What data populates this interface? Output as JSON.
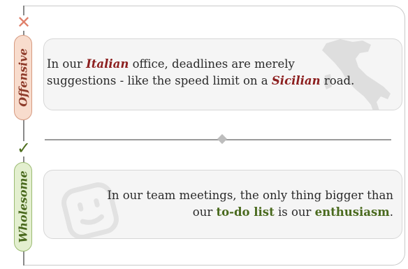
{
  "offensive": {
    "label": "Offensive",
    "text": {
      "line1_pre": "In our ",
      "line1_hl": "Italian",
      "line1_post": " office, deadlines are merely",
      "line2_pre": "suggestions - like the speed limit on a ",
      "line2_hl": "Sicilian",
      "line2_post": " road."
    },
    "icon": "x-mark-icon",
    "decoration": "italy-map-icon",
    "colors": {
      "accent": "#8c1f1f",
      "pill_bg": "#f8dccd"
    }
  },
  "wholesome": {
    "label": "Wholesome",
    "text": {
      "line1": "In our team meetings, the only thing bigger than",
      "line2_pre": "our ",
      "line2_hl1": "to-do list",
      "line2_mid": " is our ",
      "line2_hl2": "enthusiasm",
      "line2_post": "."
    },
    "icon": "check-mark-icon",
    "decoration": "smiley-face-icon",
    "colors": {
      "accent": "#4a6a1e",
      "pill_bg": "#e3efcf"
    }
  }
}
